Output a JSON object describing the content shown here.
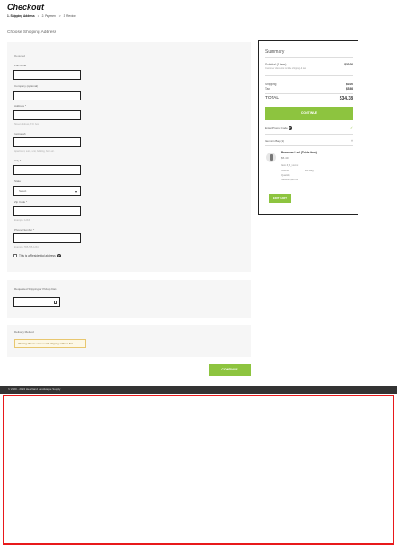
{
  "header": {
    "title": "Checkout",
    "steps": [
      {
        "label": "1. Shipping Address",
        "active": true
      },
      {
        "label": "2. Payment",
        "active": false
      },
      {
        "label": "3. Review",
        "active": false
      }
    ]
  },
  "shipping": {
    "heading": "Choose Shipping Address",
    "required_note": "Required",
    "fields": {
      "full_name": {
        "label": "Full name *",
        "value": ""
      },
      "company": {
        "label": "Company (optional)",
        "value": ""
      },
      "address": {
        "label": "Address *",
        "value": "",
        "help": "Street address, P.O. box"
      },
      "address2": {
        "label": "(optional)",
        "value": "",
        "help": "Apartment, suite, unit, building, floor etc."
      },
      "city": {
        "label": "City *",
        "value": ""
      },
      "state": {
        "label": "State *",
        "selected": "Select"
      },
      "zip": {
        "label": "Zip Code *",
        "value": "",
        "help": "Example: 12345"
      },
      "phone": {
        "label": "Phone Number *",
        "value": "",
        "help": "Example: 555-555-1234"
      }
    },
    "residential_checkbox": {
      "label": "This is a Residential address",
      "checked": false
    }
  },
  "pickup": {
    "label": "Requested Shipping or Pickup Date",
    "value": ""
  },
  "delivery": {
    "label": "Delivery Method",
    "warning": "Warning: Please enter a valid shipping address first"
  },
  "continue_label": "CONTINUE",
  "summary": {
    "title": "Summary",
    "subtotal_label": "Subtotal (1 item)",
    "subtotal_value": "$30.00",
    "subtotal_note": "Customer discounts include shipping & tax",
    "shipping_label": "Shipping",
    "shipping_value": "$0.00",
    "tax_label": "Tax",
    "tax_value": "$5.98",
    "total_label": "TOTAL",
    "total_value": "$34.38",
    "continue_label": "CONTINUE",
    "promo_label": "Enter Promo Code",
    "items_label": "Items in Bag (1)",
    "item": {
      "name": "Premium Lxxl (Triple item)",
      "price": "$5.40",
      "sku_label": "Item #_5_xxxxxx",
      "rows": [
        {
          "label": "Volume",
          "value": "250 Bkg"
        },
        {
          "label": "Quantity",
          "value": "1"
        },
        {
          "label": "Subtotal",
          "value": "$30.00"
        }
      ]
    },
    "edit_cart_label": "EDIT CART"
  },
  "footer": {
    "text": "© 2020 - 2024 Heartland Landscape Supply"
  },
  "colors": {
    "accent_green": "#8dc43f",
    "highlight_red": "#e8191b",
    "footer_dark": "#333333"
  }
}
